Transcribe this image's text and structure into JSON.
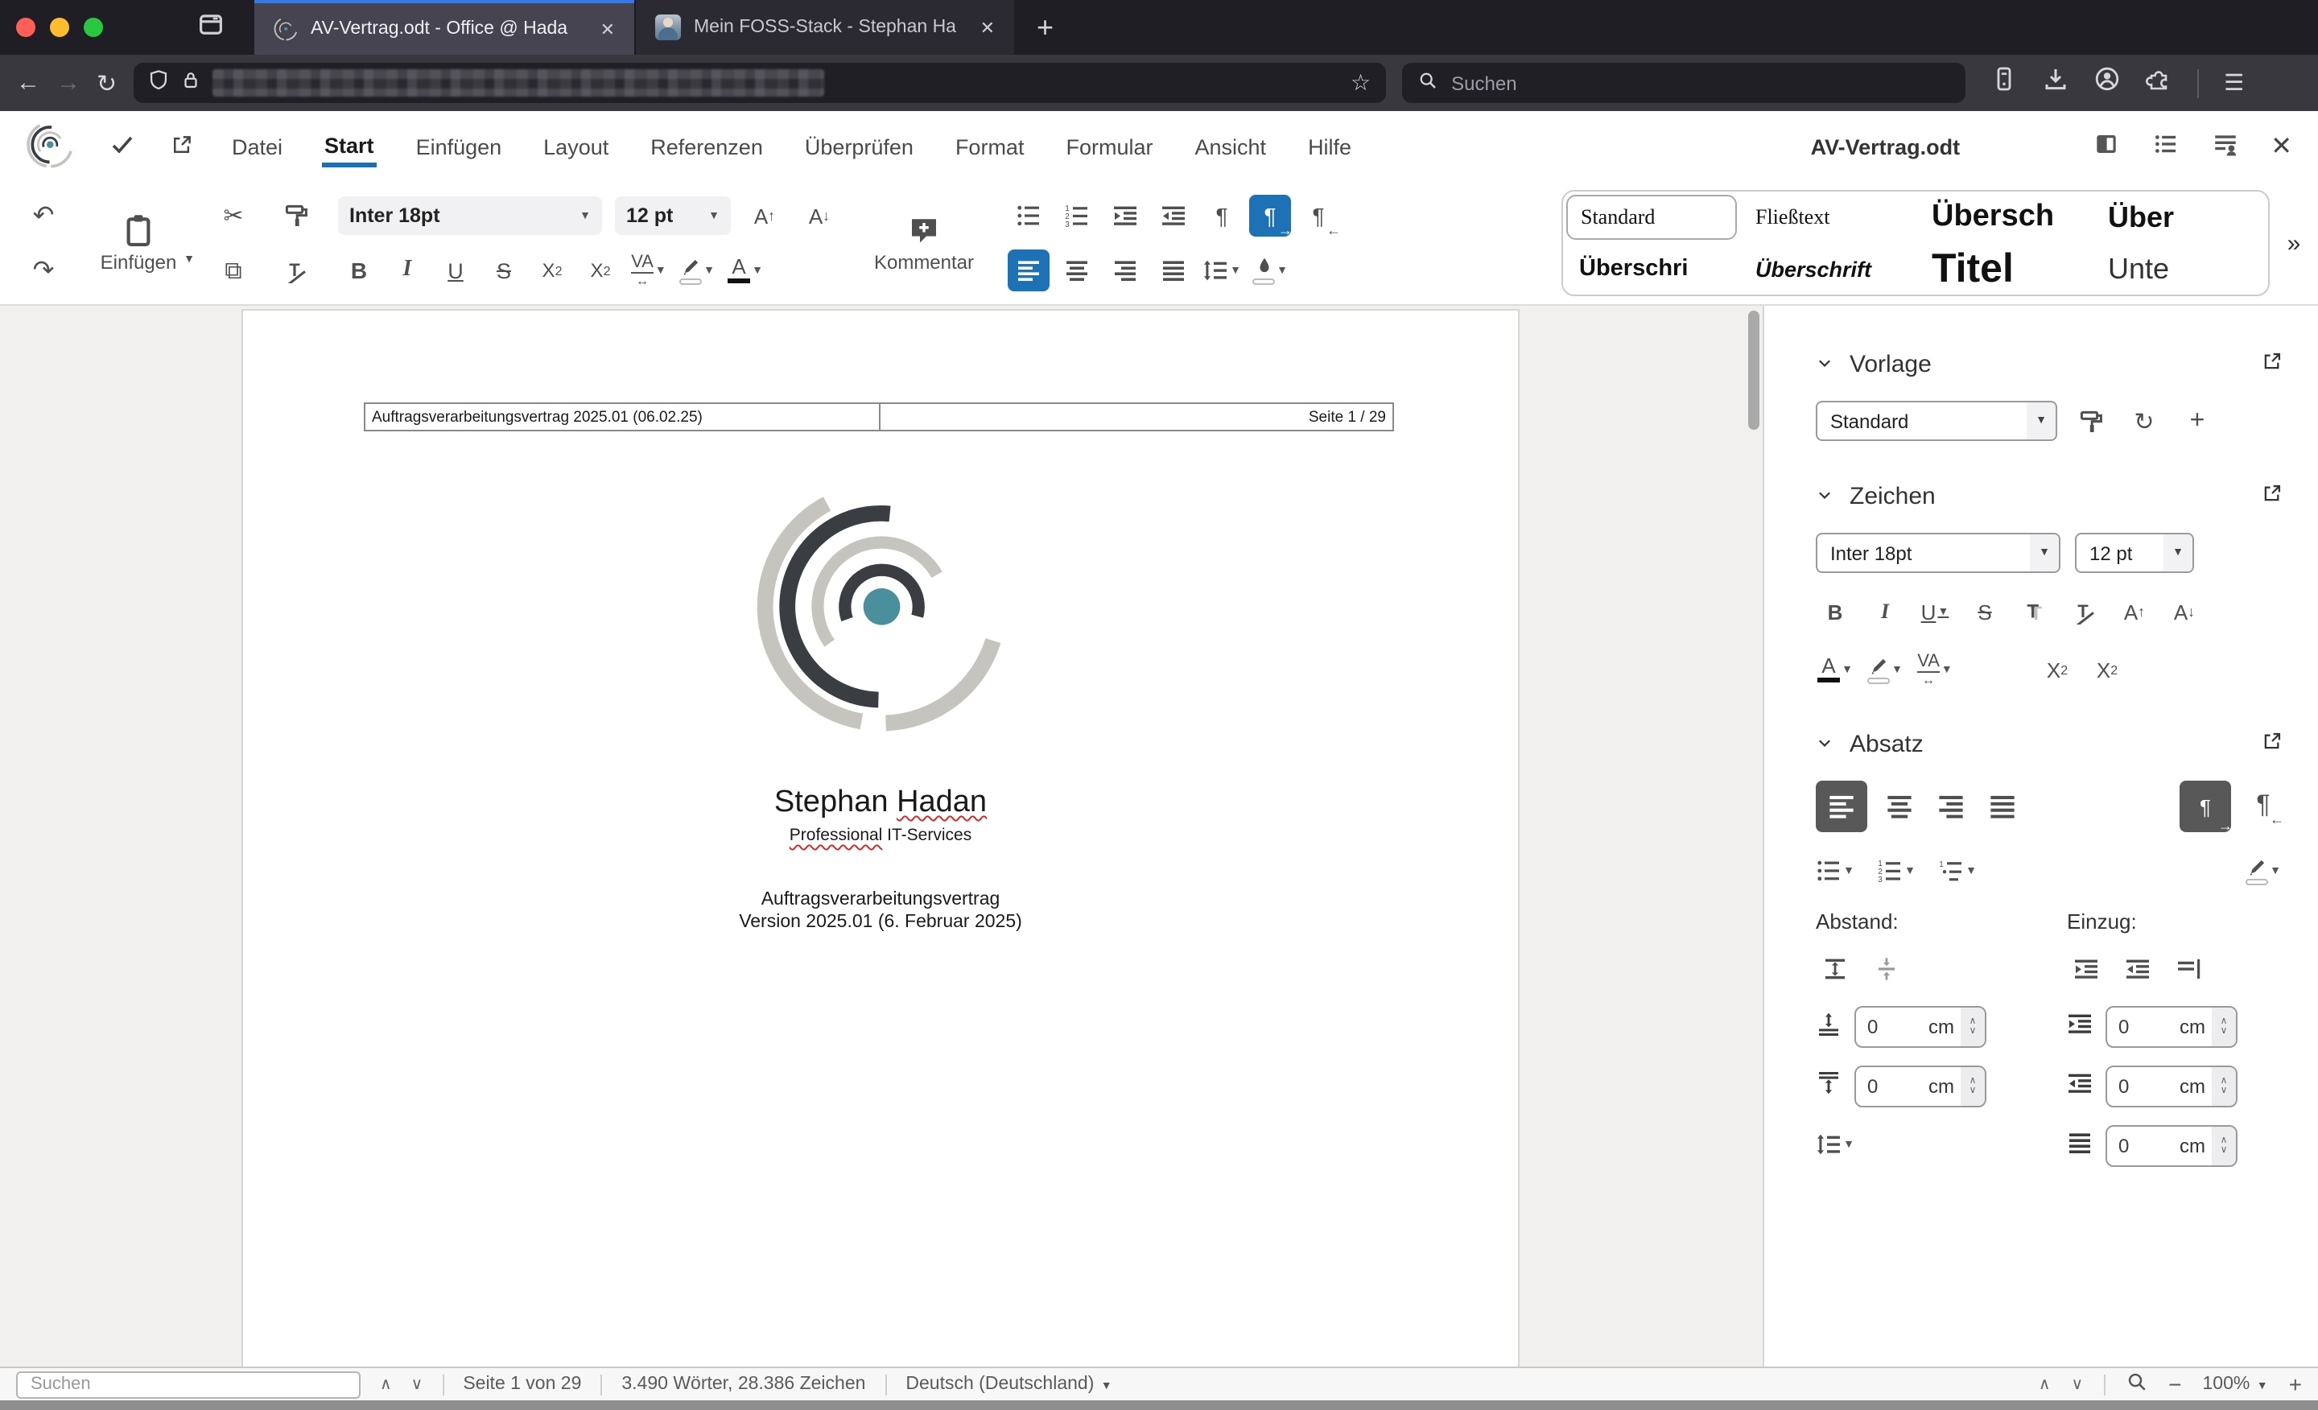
{
  "browser": {
    "tabs": [
      {
        "title": "AV-Vertrag.odt - Office @ Hada",
        "close": "✕"
      },
      {
        "title": "Mein FOSS-Stack - Stephan Ha",
        "close": "✕"
      }
    ],
    "new_tab_label": "+",
    "nav": {
      "back": "←",
      "forward": "→",
      "reload": "↻",
      "menu": "☰",
      "star": "☆",
      "search_placeholder": "Suchen"
    }
  },
  "app": {
    "menu": {
      "items": [
        "Datei",
        "Start",
        "Einfügen",
        "Layout",
        "Referenzen",
        "Überprüfen",
        "Format",
        "Formular",
        "Ansicht",
        "Hilfe"
      ],
      "document_title": "AV-Vertrag.odt"
    },
    "toolbar": {
      "undo": "↶",
      "redo": "↷",
      "cut": "✂",
      "copy": "⧉",
      "paste_label": "Einfügen",
      "font_name": "Inter 18pt",
      "font_size": "12 pt",
      "glyphs": {
        "bold": "B",
        "italic": "I",
        "underline": "U",
        "strike": "S",
        "x": "X",
        "two": "2",
        "spacing": "VA",
        "spacing_arrow": "↔",
        "font_color": "A",
        "grow": "A",
        "grow_arrow": "↑",
        "shrink": "A",
        "shrink_arrow": "↓",
        "pilcrow": "¶",
        "ltr_arrow": "→",
        "rtl_arrow": "←",
        "shadow": "T"
      },
      "comment_label": "Kommentar",
      "styles": [
        "Standard",
        "Fließtext",
        "Übersch",
        "Über",
        "Überschri",
        "Überschrift",
        "Titel",
        "Unte"
      ],
      "more": "»"
    },
    "sidebar": {
      "vorlage": {
        "title": "Vorlage",
        "value": "Standard"
      },
      "zeichen": {
        "title": "Zeichen",
        "font": "Inter 18pt",
        "size": "12 pt"
      },
      "absatz": {
        "title": "Absatz",
        "abstand_label": "Abstand:",
        "einzug_label": "Einzug:",
        "spacing_fields": [
          {
            "value": "0",
            "unit": "cm"
          },
          {
            "value": "0",
            "unit": "cm"
          }
        ],
        "indent_fields": [
          {
            "value": "0",
            "unit": "cm"
          },
          {
            "value": "0",
            "unit": "cm"
          },
          {
            "value": "0",
            "unit": "cm"
          }
        ]
      }
    },
    "statusbar": {
      "search_placeholder": "Suchen",
      "page": "Seite 1 von 29",
      "words": "3.490 Wörter, 28.386 Zeichen",
      "language": "Deutsch (Deutschland)",
      "zoom": "100%",
      "zoom_out": "−",
      "zoom_in": "+"
    }
  },
  "document": {
    "header": {
      "left": "Auftragsverarbeitungsvertrag 2025.01 (06.02.25)",
      "right": "Seite 1 / 29"
    },
    "author_first": "Stephan ",
    "author_last": "Hadan",
    "subtitle_word": "Professional",
    "subtitle_rest": " IT-Services",
    "title_line1": "Auftragsverarbeitungsvertrag",
    "title_line2": "Version 2025.01 (6. Februar 2025)"
  },
  "colors": {
    "accent_blue": "#1d72b5",
    "tab_accent": "#3778e8",
    "logo_teal": "#4a8f9c",
    "logo_dark": "#3a3e42",
    "logo_gray": "#c6c4be"
  }
}
